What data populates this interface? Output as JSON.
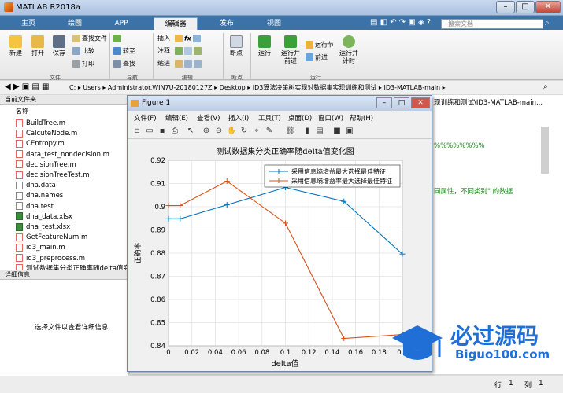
{
  "window": {
    "title": "MATLAB R2018a"
  },
  "tabs": [
    {
      "label": "主页",
      "active": false
    },
    {
      "label": "绘图",
      "active": false
    },
    {
      "label": "APP",
      "active": false
    },
    {
      "label": "编辑器",
      "active": true
    },
    {
      "label": "发布",
      "active": false
    },
    {
      "label": "视图",
      "active": false
    }
  ],
  "search": {
    "placeholder": "搜索文档"
  },
  "ribbon": {
    "file": {
      "new": "新建",
      "open": "打开",
      "save": "保存",
      "find_files": "查找文件",
      "compare": "比较",
      "print": "打印",
      "group": "文件"
    },
    "nav": {
      "goto": "转至",
      "find": "查找",
      "group": "导航"
    },
    "edit": {
      "insert": "插入",
      "comment": "注释",
      "indent": "缩进",
      "fx": "fx",
      "group": "编辑"
    },
    "breakpoints": {
      "label": "断点",
      "group": "断点"
    },
    "run": {
      "run": "运行",
      "run_advance": "运行并\n前进",
      "run_section": "运行节",
      "advance": "前进",
      "run_time": "运行并\n计时",
      "group": "运行"
    }
  },
  "address": {
    "path": [
      "C:",
      "Users",
      "Administrator.WIN7U-20180127Z",
      "Desktop",
      "ID3算法决策树实现对数据集实现训练和测试",
      "ID3-MATLAB-main"
    ]
  },
  "current_folder": {
    "title": "当前文件夹",
    "column": "名称",
    "files": [
      {
        "name": "BuildTree.m",
        "type": "m"
      },
      {
        "name": "CalcuteNode.m",
        "type": "m"
      },
      {
        "name": "CEntropy.m",
        "type": "m"
      },
      {
        "name": "data_test_nondecision.m",
        "type": "m"
      },
      {
        "name": "decisionTree.m",
        "type": "m"
      },
      {
        "name": "decisionTreeTest.m",
        "type": "m"
      },
      {
        "name": "dna.data",
        "type": "d"
      },
      {
        "name": "dna.names",
        "type": "d"
      },
      {
        "name": "dna.test",
        "type": "d"
      },
      {
        "name": "dna_data.xlsx",
        "type": "x"
      },
      {
        "name": "dna_test.xlsx",
        "type": "x"
      },
      {
        "name": "GetFeatureNum.m",
        "type": "m"
      },
      {
        "name": "id3_main.m",
        "type": "m"
      },
      {
        "name": "id3_preprocess.m",
        "type": "m"
      },
      {
        "name": "测试数据集分类正确率随delta值变",
        "type": "m"
      }
    ]
  },
  "details": {
    "title": "详细信息",
    "hint": "选择文件以查看详细信息"
  },
  "editor": {
    "tab_text": "现训练和测试\\ID3-MATLAB-main...",
    "line_a": "%%%%%%%%",
    "line_b": "同属性，不同类别\" 的数据"
  },
  "statusbar": {
    "row_label": "行",
    "row": "1",
    "col_label": "列",
    "col": "1"
  },
  "figure": {
    "title": "Figure 1",
    "menu": [
      "文件(F)",
      "编辑(E)",
      "查看(V)",
      "插入(I)",
      "工具(T)",
      "桌面(D)",
      "窗口(W)",
      "帮助(H)"
    ]
  },
  "chart_data": {
    "type": "line",
    "title": "测试数据集分类正确率随delta值变化图",
    "xlabel": "delta值",
    "ylabel": "正确率",
    "xlim": [
      0,
      0.2
    ],
    "ylim": [
      0.84,
      0.92
    ],
    "xticks": [
      "0",
      "0.02",
      "0.04",
      "0.06",
      "0.08",
      "0.1",
      "0.12",
      "0.14",
      "0.16",
      "0.18",
      "0.2"
    ],
    "yticks": [
      "0.84",
      "0.85",
      "0.86",
      "0.87",
      "0.88",
      "0.89",
      "0.9",
      "0.91",
      "0.92"
    ],
    "grid": true,
    "legend_position": "top-right",
    "series": [
      {
        "name": "采用信息熵增益最大选择最佳特征",
        "color": "#0072bd",
        "marker": "+",
        "x": [
          0,
          0.01,
          0.05,
          0.1,
          0.15,
          0.2
        ],
        "y": [
          0.8948,
          0.8948,
          0.9008,
          0.9083,
          0.9023,
          0.8796
        ]
      },
      {
        "name": "采用信息熵增益率最大选择最佳特征",
        "color": "#d95319",
        "marker": "+",
        "x": [
          0,
          0.01,
          0.05,
          0.1,
          0.15,
          0.2
        ],
        "y": [
          0.9005,
          0.9005,
          0.911,
          0.8929,
          0.8432,
          0.8449
        ]
      }
    ]
  },
  "watermark": {
    "brand": "必过源码",
    "site": "Biguo100.com"
  }
}
